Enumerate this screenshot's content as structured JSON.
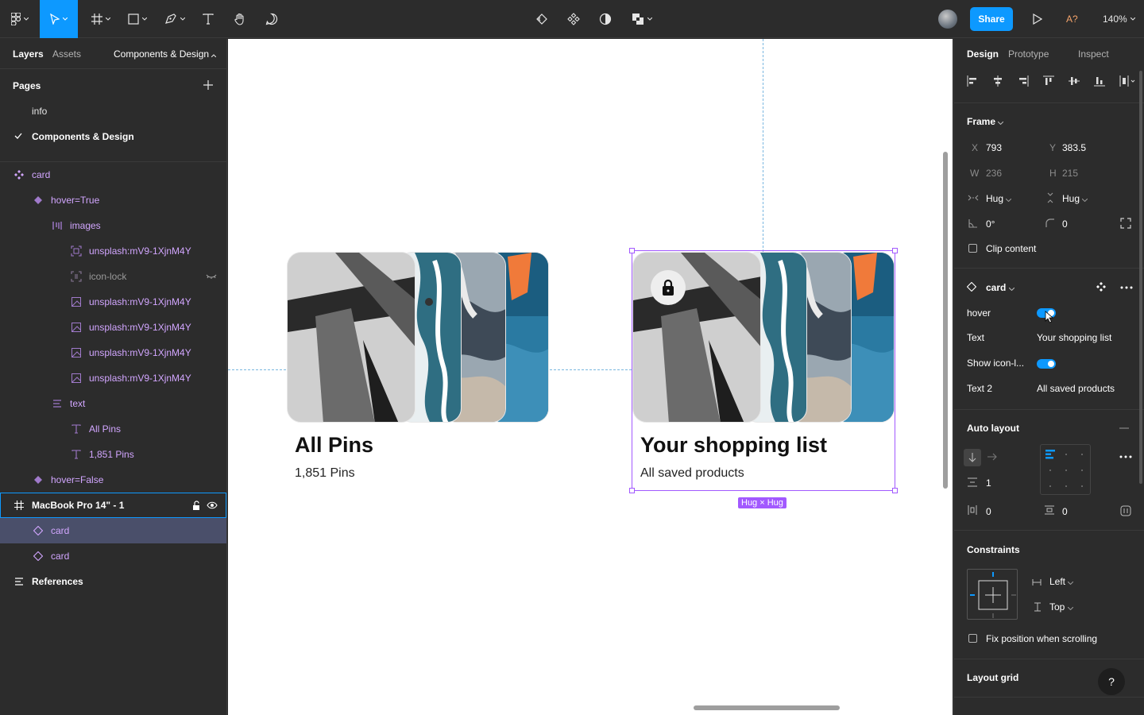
{
  "toolbar": {
    "share_label": "Share",
    "a_badge": "A?",
    "zoom": "140%",
    "icons": [
      "figma-menu-icon",
      "move-tool-icon",
      "frame-tool-icon",
      "shape-tool-icon",
      "pen-tool-icon",
      "text-tool-icon",
      "hand-tool-icon",
      "comment-tool-icon",
      "reset-instance-icon",
      "component-icon",
      "contrast-icon",
      "boolean-ops-icon",
      "play-icon"
    ]
  },
  "left_panel": {
    "tabs": [
      "Layers",
      "Assets"
    ],
    "page_selector": "Components & Design",
    "pages_heading": "Pages",
    "pages": [
      {
        "label": "info"
      },
      {
        "label": "Components & Design"
      }
    ],
    "layers": [
      {
        "label": "card"
      },
      {
        "label": "hover=True"
      },
      {
        "label": "images"
      },
      {
        "label": "unsplash:mV9-1XjnM4Y"
      },
      {
        "label": "icon-lock"
      },
      {
        "label": "unsplash:mV9-1XjnM4Y"
      },
      {
        "label": "unsplash:mV9-1XjnM4Y"
      },
      {
        "label": "unsplash:mV9-1XjnM4Y"
      },
      {
        "label": "unsplash:mV9-1XjnM4Y"
      },
      {
        "label": "text"
      },
      {
        "label": "All Pins"
      },
      {
        "label": "1,851 Pins"
      },
      {
        "label": "hover=False"
      },
      {
        "label": "MacBook Pro 14\" - 1"
      },
      {
        "label": "card"
      },
      {
        "label": "card"
      },
      {
        "label": "References"
      }
    ]
  },
  "canvas": {
    "cards": [
      {
        "title": "All Pins",
        "subtitle": "1,851 Pins"
      },
      {
        "title": "Your shopping list",
        "subtitle": "All saved products"
      }
    ],
    "hug_badge": "Hug × Hug"
  },
  "right_panel": {
    "tabs": [
      "Design",
      "Prototype",
      "Inspect"
    ],
    "frame": {
      "heading": "Frame",
      "x_label": "X",
      "x": "793",
      "y_label": "Y",
      "y": "383.5",
      "w_label": "W",
      "w": "236",
      "h_label": "H",
      "h": "215",
      "hug_w": "Hug",
      "hug_h": "Hug",
      "rotation": "0°",
      "radius": "0",
      "clip": "Clip content"
    },
    "component": {
      "name": "card",
      "props": [
        {
          "label": "hover",
          "type": "toggle"
        },
        {
          "label": "Text",
          "value": "Your shopping list"
        },
        {
          "label": "Show icon-l...",
          "type": "toggle"
        },
        {
          "label": "Text 2",
          "value": "All saved products"
        }
      ]
    },
    "auto_layout": {
      "heading": "Auto layout",
      "gap": "1",
      "padding_h": "0",
      "padding_v": "0"
    },
    "constraints": {
      "heading": "Constraints",
      "horizontal": "Left",
      "vertical": "Top",
      "fix": "Fix position when scrolling"
    },
    "layout_grid": "Layout grid",
    "help": "?"
  },
  "colors": {
    "accent": "#0d99ff",
    "component_purple": "#a259ff",
    "panel_bg": "#2c2c2c"
  }
}
